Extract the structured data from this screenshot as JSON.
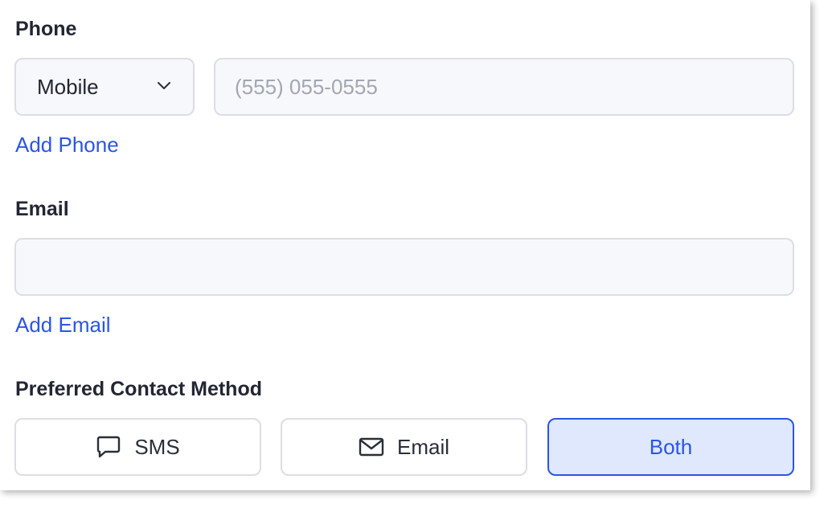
{
  "phone": {
    "label": "Phone",
    "type_select": {
      "selected": "Mobile",
      "icon": "chevron-down-icon"
    },
    "number_input": {
      "value": "",
      "placeholder": "(555) 055-0555"
    },
    "add_link": "Add Phone"
  },
  "email": {
    "label": "Email",
    "input": {
      "value": "",
      "placeholder": ""
    },
    "add_link": "Add Email"
  },
  "contact_method": {
    "label": "Preferred Contact Method",
    "options": [
      {
        "label": "SMS",
        "icon": "chat-bubble-icon",
        "selected": false
      },
      {
        "label": "Email",
        "icon": "envelope-icon",
        "selected": false
      },
      {
        "label": "Both",
        "icon": "",
        "selected": true
      }
    ]
  },
  "colors": {
    "accent": "#2b55e6",
    "selected_bg": "#dfe8fd",
    "field_bg": "#f7f8fb",
    "border": "#dcdee4"
  }
}
